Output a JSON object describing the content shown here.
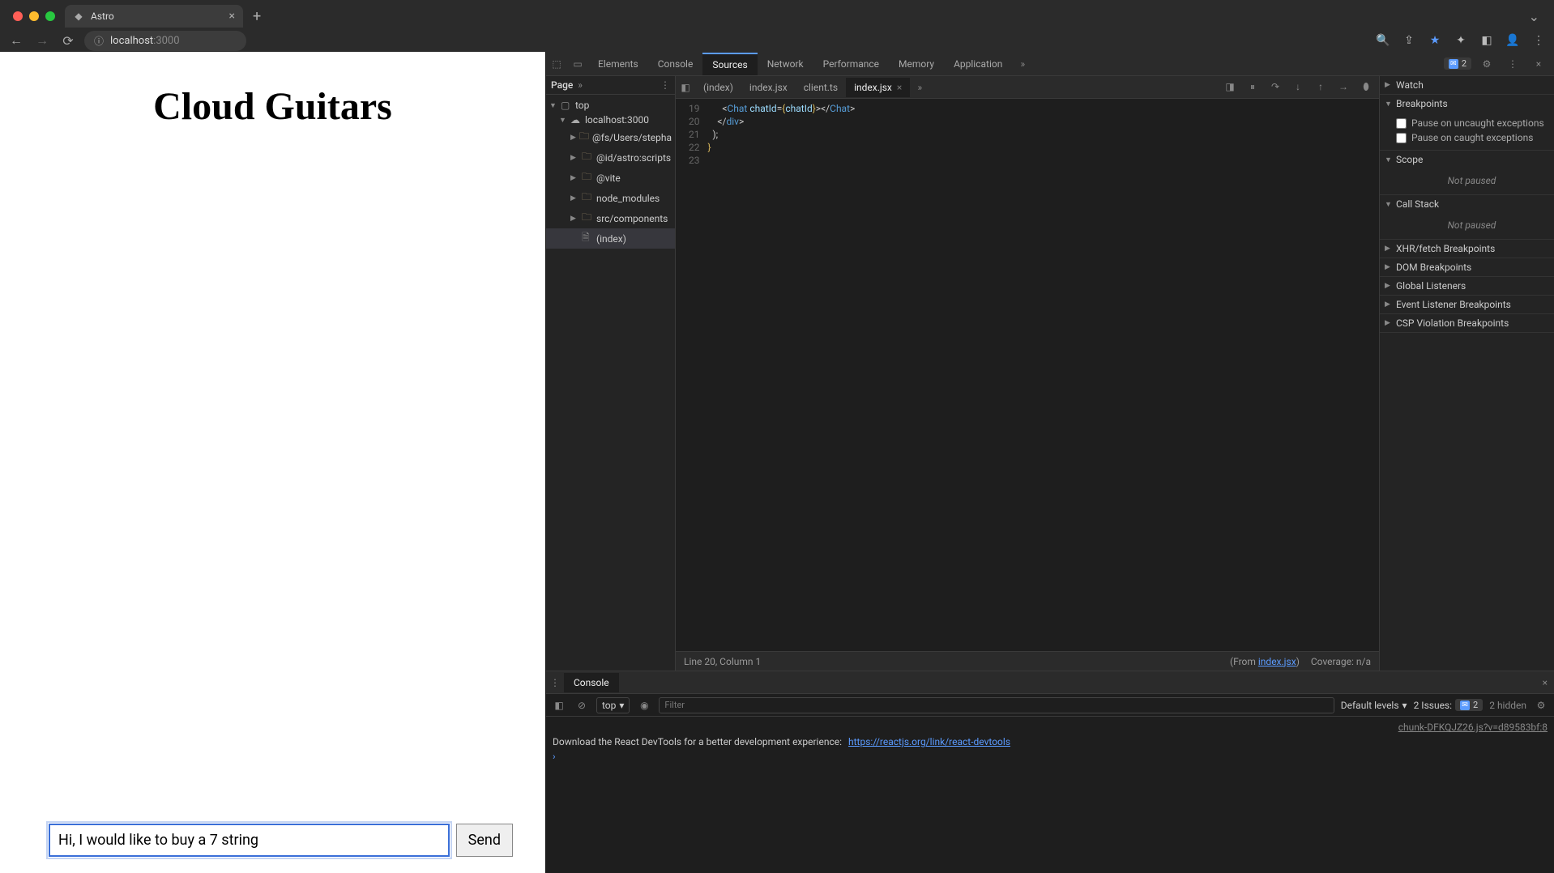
{
  "browser": {
    "tab_title": "Astro",
    "url_host": "localhost",
    "url_port": ":3000"
  },
  "page": {
    "heading": "Cloud Guitars",
    "input_value": "Hi, I would like to buy a 7 string",
    "send_label": "Send"
  },
  "devtools": {
    "tabs": [
      "Elements",
      "Console",
      "Sources",
      "Network",
      "Performance",
      "Memory",
      "Application"
    ],
    "active_tab": "Sources",
    "issues_count": "2",
    "sources": {
      "nav_tab": "Page",
      "tree": {
        "top": "top",
        "host": "localhost:3000",
        "folders": [
          "@fs/Users/stepha",
          "@id/astro:scripts",
          "@vite",
          "node_modules",
          "src/components"
        ],
        "file": "(index)"
      },
      "editor_tabs": [
        "(index)",
        "index.jsx",
        "client.ts",
        "index.jsx"
      ],
      "active_editor_tab": 3,
      "line_numbers": [
        "19",
        "20",
        "21",
        "22",
        "23"
      ],
      "code_lines": [
        {
          "indent": "      ",
          "tokens": [
            {
              "t": "<",
              "c": "punc"
            },
            {
              "t": "Chat",
              "c": "tag"
            },
            {
              "t": " ",
              "c": ""
            },
            {
              "t": "chatId",
              "c": "attr"
            },
            {
              "t": "=",
              "c": "punc"
            },
            {
              "t": "{",
              "c": "brace"
            },
            {
              "t": "chatId",
              "c": "attr"
            },
            {
              "t": "}",
              "c": "brace"
            },
            {
              "t": ">",
              "c": "punc"
            },
            {
              "t": "</",
              "c": "punc"
            },
            {
              "t": "Chat",
              "c": "tag"
            },
            {
              "t": ">",
              "c": "punc"
            }
          ]
        },
        {
          "indent": "    ",
          "tokens": [
            {
              "t": "</",
              "c": "punc"
            },
            {
              "t": "div",
              "c": "tag"
            },
            {
              "t": ">",
              "c": "punc"
            }
          ]
        },
        {
          "indent": "  ",
          "tokens": [
            {
              "t": ");",
              "c": "punc"
            }
          ]
        },
        {
          "indent": "",
          "tokens": [
            {
              "t": "}",
              "c": "brace"
            }
          ]
        },
        {
          "indent": "",
          "tokens": []
        }
      ],
      "status_pos": "Line 20, Column 1",
      "status_from": "(From ",
      "status_from_link": "index.jsx",
      "status_from_close": ")",
      "status_coverage": "Coverage: n/a"
    },
    "debugger": {
      "sections": [
        {
          "title": "Watch",
          "collapsed": true
        },
        {
          "title": "Breakpoints",
          "collapsed": false,
          "checks": [
            "Pause on uncaught exceptions",
            "Pause on caught exceptions"
          ]
        },
        {
          "title": "Scope",
          "collapsed": false,
          "not_paused": "Not paused"
        },
        {
          "title": "Call Stack",
          "collapsed": false,
          "not_paused": "Not paused"
        },
        {
          "title": "XHR/fetch Breakpoints",
          "collapsed": true
        },
        {
          "title": "DOM Breakpoints",
          "collapsed": true
        },
        {
          "title": "Global Listeners",
          "collapsed": true
        },
        {
          "title": "Event Listener Breakpoints",
          "collapsed": true
        },
        {
          "title": "CSP Violation Breakpoints",
          "collapsed": true
        }
      ]
    },
    "console": {
      "drawer_tab": "Console",
      "context": "top",
      "filter_placeholder": "Filter",
      "levels": "Default levels",
      "issues_label": "2 Issues:",
      "issues_badge": "2",
      "hidden": "2 hidden",
      "msg_source": "chunk-DFKQJZ26.js?v=d89583bf:8",
      "msg_text": "Download the React DevTools for a better development experience: ",
      "msg_link": "https://reactjs.org/link/react-devtools"
    }
  }
}
